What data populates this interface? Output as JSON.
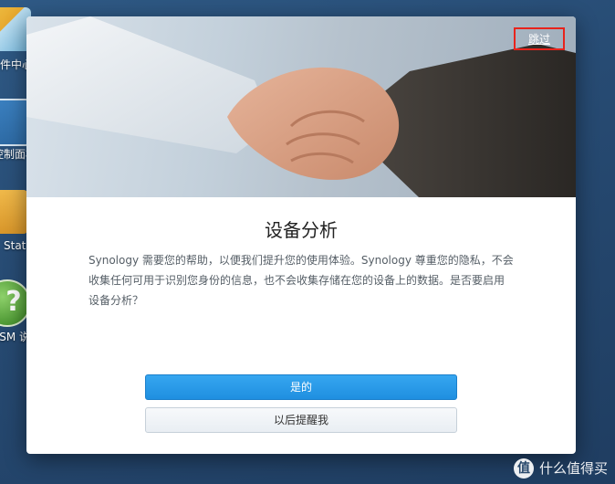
{
  "desktop": {
    "icons": [
      {
        "label": "套件中心"
      },
      {
        "label": "控制面板"
      },
      {
        "label": "Stat"
      },
      {
        "label": "DSM 说"
      }
    ]
  },
  "dialog": {
    "skip_label": "跳过",
    "title": "设备分析",
    "description": "Synology 需要您的帮助，以便我们提升您的使用体验。Synology 尊重您的隐私，不会收集任何可用于识别您身份的信息，也不会收集存储在您的设备上的数据。是否要启用设备分析？",
    "primary_button": "是的",
    "secondary_button": "以后提醒我"
  },
  "watermark": {
    "logo_text": "值",
    "text": "什么值得买"
  },
  "colors": {
    "primary_button": "#1f8fe0",
    "highlight_border": "#e8231c",
    "desktop_bg": "#274b73"
  }
}
